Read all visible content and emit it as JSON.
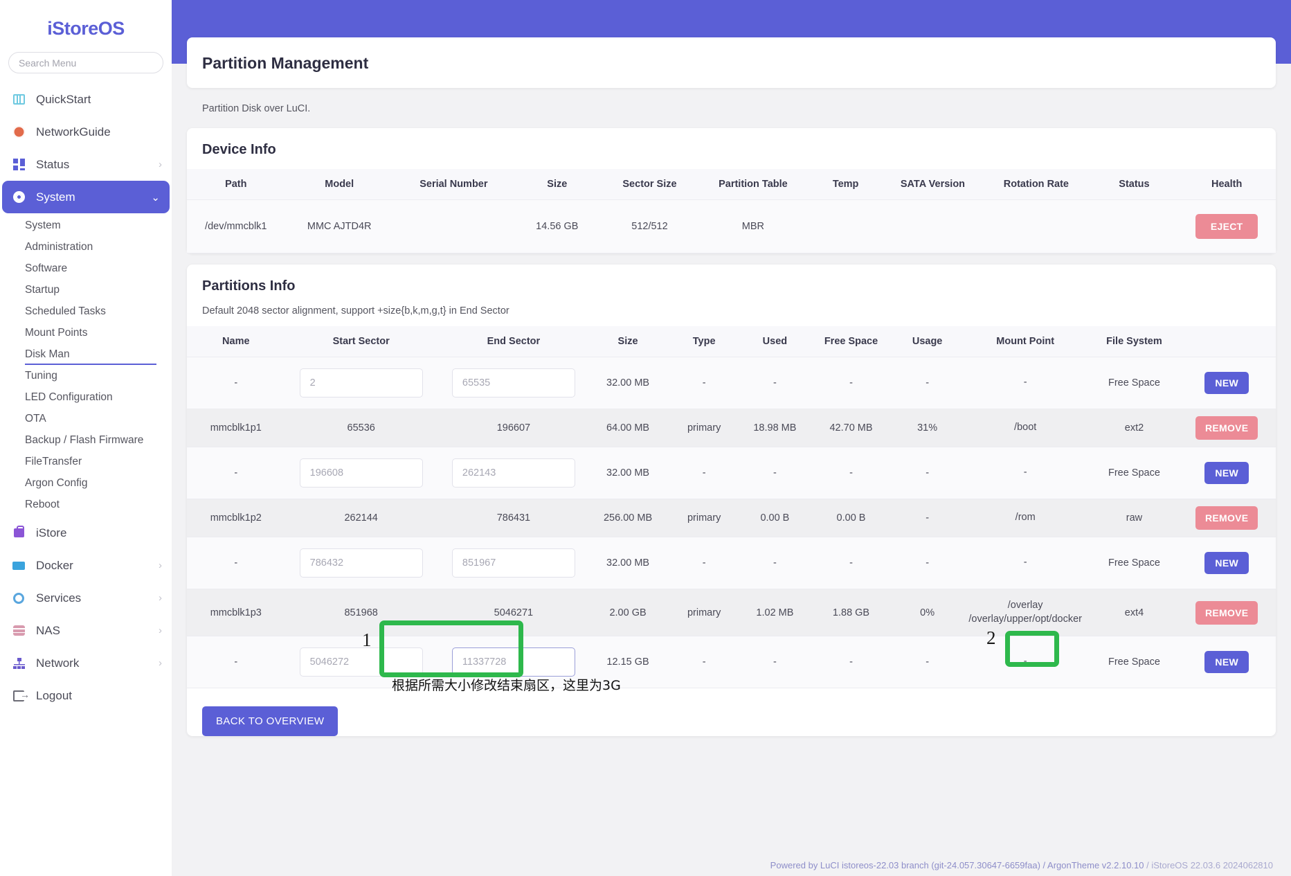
{
  "sidebar": {
    "brand": "iStoreOS",
    "search_placeholder": "Search Menu",
    "items": [
      {
        "label": "QuickStart",
        "icon": "quickstart-icon",
        "chevron": ""
      },
      {
        "label": "NetworkGuide",
        "icon": "globe-icon",
        "chevron": ""
      },
      {
        "label": "Status",
        "icon": "status-icon",
        "chevron": "›"
      },
      {
        "label": "System",
        "icon": "gear-icon",
        "chevron": "⌄",
        "active": true
      }
    ],
    "system_subitems": [
      "System",
      "Administration",
      "Software",
      "Startup",
      "Scheduled Tasks",
      "Mount Points",
      "Disk Man",
      "Tuning",
      "LED Configuration",
      "OTA",
      "Backup / Flash Firmware",
      "FileTransfer",
      "Argon Config",
      "Reboot"
    ],
    "selected_subitem": "Disk Man",
    "bottom_items": [
      {
        "label": "iStore",
        "icon": "store-icon",
        "chevron": ""
      },
      {
        "label": "Docker",
        "icon": "docker-icon",
        "chevron": "›"
      },
      {
        "label": "Services",
        "icon": "services-icon",
        "chevron": "›"
      },
      {
        "label": "NAS",
        "icon": "nas-icon",
        "chevron": "›"
      },
      {
        "label": "Network",
        "icon": "network-icon",
        "chevron": "›"
      },
      {
        "label": "Logout",
        "icon": "logout-icon",
        "chevron": ""
      }
    ]
  },
  "page": {
    "title": "Partition Management",
    "description": "Partition Disk over LuCI.",
    "back_button": "BACK TO OVERVIEW"
  },
  "device_info": {
    "title": "Device Info",
    "columns": [
      "Path",
      "Model",
      "Serial Number",
      "Size",
      "Sector Size",
      "Partition Table",
      "Temp",
      "SATA Version",
      "Rotation Rate",
      "Status",
      "Health"
    ],
    "rows": [
      {
        "path": "/dev/mmcblk1",
        "model": "MMC AJTD4R",
        "serial": "",
        "size": "14.56 GB",
        "sector_size": "512/512",
        "partition_table": "MBR",
        "temp": "",
        "sata_version": "",
        "rotation_rate": "",
        "status": "",
        "health": "",
        "action": "EJECT"
      }
    ]
  },
  "partitions_info": {
    "title": "Partitions Info",
    "subtitle": "Default 2048 sector alignment, support +size{b,k,m,g,t} in End Sector",
    "columns": [
      "Name",
      "Start Sector",
      "End Sector",
      "Size",
      "Type",
      "Used",
      "Free Space",
      "Usage",
      "Mount Point",
      "File System"
    ],
    "rows": [
      {
        "name": "-",
        "start_sector": "2",
        "end_sector": "65535",
        "editable": true,
        "size": "32.00 MB",
        "type": "-",
        "used": "-",
        "free_space": "-",
        "usage": "-",
        "mount_point": "-",
        "file_system": "Free Space",
        "action": "NEW",
        "action_kind": "new"
      },
      {
        "name": "mmcblk1p1",
        "start_sector": "65536",
        "end_sector": "196607",
        "editable": false,
        "size": "64.00 MB",
        "type": "primary",
        "used": "18.98 MB",
        "free_space": "42.70 MB",
        "usage": "31%",
        "mount_point": "/boot",
        "file_system": "ext2",
        "action": "REMOVE",
        "action_kind": "remove"
      },
      {
        "name": "-",
        "start_sector": "196608",
        "end_sector": "262143",
        "editable": true,
        "size": "32.00 MB",
        "type": "-",
        "used": "-",
        "free_space": "-",
        "usage": "-",
        "mount_point": "-",
        "file_system": "Free Space",
        "action": "NEW",
        "action_kind": "new"
      },
      {
        "name": "mmcblk1p2",
        "start_sector": "262144",
        "end_sector": "786431",
        "editable": false,
        "size": "256.00 MB",
        "type": "primary",
        "used": "0.00 B",
        "free_space": "0.00 B",
        "usage": "-",
        "mount_point": "/rom",
        "file_system": "raw",
        "action": "REMOVE",
        "action_kind": "remove"
      },
      {
        "name": "-",
        "start_sector": "786432",
        "end_sector": "851967",
        "editable": true,
        "size": "32.00 MB",
        "type": "-",
        "used": "-",
        "free_space": "-",
        "usage": "-",
        "mount_point": "-",
        "file_system": "Free Space",
        "action": "NEW",
        "action_kind": "new"
      },
      {
        "name": "mmcblk1p3",
        "start_sector": "851968",
        "end_sector": "5046271",
        "editable": false,
        "size": "2.00 GB",
        "type": "primary",
        "used": "1.02 MB",
        "free_space": "1.88 GB",
        "usage": "0%",
        "mount_point": "/overlay\n/overlay/upper/opt/docker",
        "file_system": "ext4",
        "action": "REMOVE",
        "action_kind": "remove"
      },
      {
        "name": "-",
        "start_sector": "5046272",
        "end_sector": "11337728",
        "editable": true,
        "size": "12.15 GB",
        "type": "-",
        "used": "-",
        "free_space": "-",
        "usage": "-",
        "mount_point": "-",
        "file_system": "Free Space",
        "action": "NEW",
        "action_kind": "new"
      }
    ]
  },
  "annotations": {
    "step1": "1",
    "step2": "2",
    "note_cn": "根据所需大小修改结束扇区，这里为3G"
  },
  "footer": {
    "powered": "Powered by LuCI istoreos-22.03 branch (git-24.057.30647-6659faa) / ArgonTheme v2.2.10.10",
    "version": " / iStoreOS 22.03.6 2024062810"
  },
  "colors": {
    "accent": "#5b5fd6",
    "danger": "#ec8b96",
    "highlight": "#2eb84c"
  }
}
